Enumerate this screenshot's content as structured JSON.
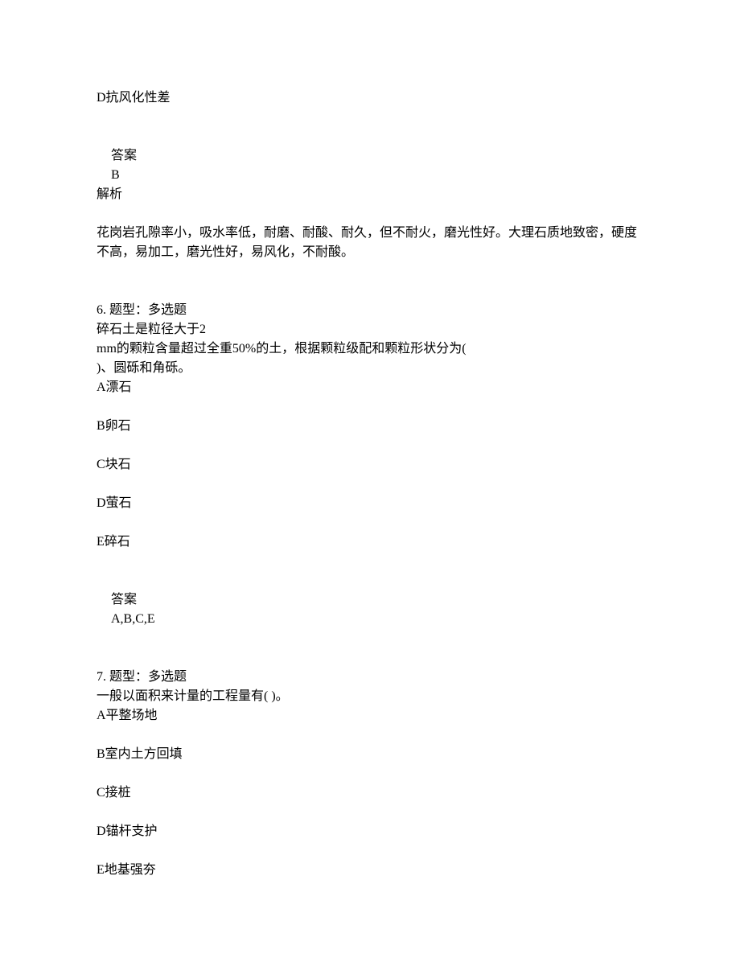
{
  "q5_partial": {
    "optionD": "D抗风化性差",
    "answer_label": "答案",
    "answer_value": "B",
    "explain_label": "解析",
    "explain_text": "花岗岩孔隙率小，吸水率低，耐磨、耐酸、耐久，但不耐火，磨光性好。大理石质地致密，硬度不高，易加工，磨光性好，易风化，不耐酸。"
  },
  "q6": {
    "header": "6. 题型：多选题",
    "stem_line1": "碎石土是粒径大于2",
    "stem_line2": "mm的颗粒含量超过全重50%的土，根据颗粒级配和颗粒形状分为(",
    "stem_line3": ")、圆砾和角砾。",
    "options": {
      "A": "A漂石",
      "B": "B卵石",
      "C": "C块石",
      "D": "D萤石",
      "E": "E碎石"
    },
    "answer_label": "答案",
    "answer_value": "A,B,C,E"
  },
  "q7": {
    "header": "7. 题型：多选题",
    "stem": "一般以面积来计量的工程量有(        )。",
    "options": {
      "A": "A平整场地",
      "B": "B室内土方回填",
      "C": "C接桩",
      "D": "D锚杆支护",
      "E": "E地基强夯"
    }
  }
}
